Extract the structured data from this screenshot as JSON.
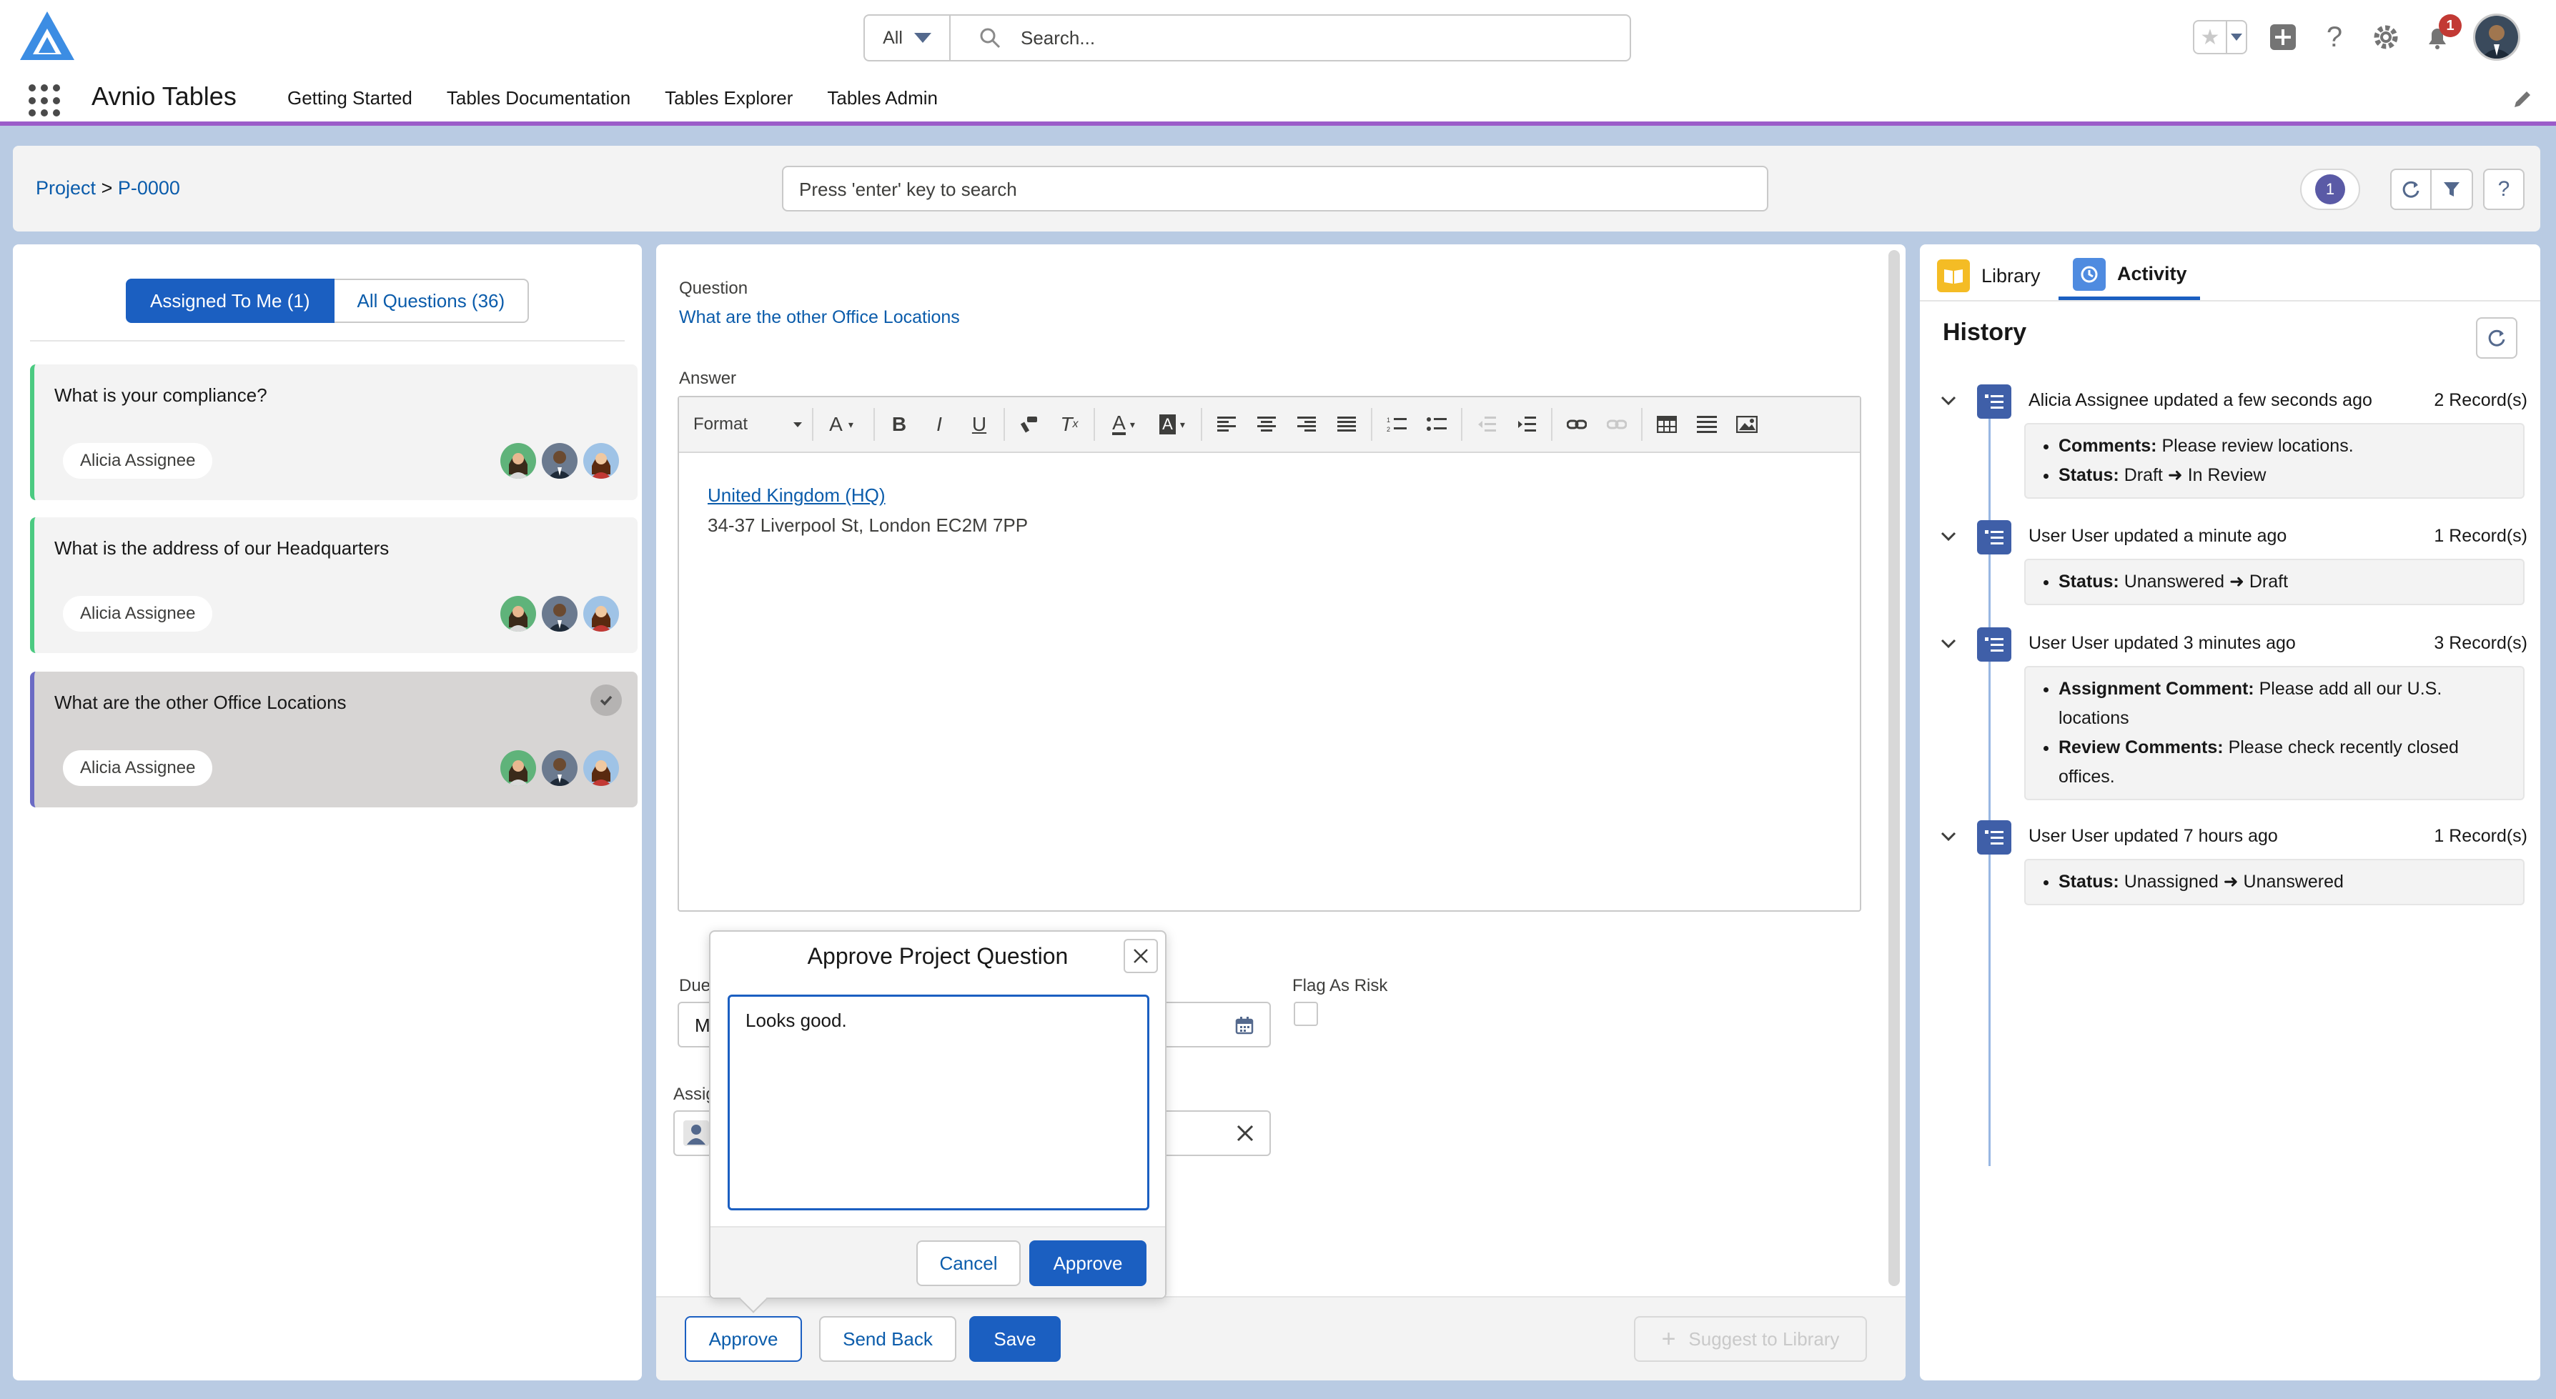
{
  "app": {
    "name": "Avnio Tables",
    "nav": [
      "Getting Started",
      "Tables Documentation",
      "Tables Explorer",
      "Tables Admin"
    ],
    "notification_count": "1"
  },
  "global_search": {
    "scope": "All",
    "placeholder": "Search..."
  },
  "breadcrumb": {
    "parent": "Project",
    "separator": ">",
    "current": "P-0000"
  },
  "sub_search": {
    "placeholder": "Press 'enter' key to search"
  },
  "filter_count": "1",
  "left": {
    "tabs": {
      "assigned": "Assigned To Me (1)",
      "all": "All Questions (36)"
    },
    "questions": [
      {
        "title": "What is your compliance?",
        "assignee": "Alicia Assignee"
      },
      {
        "title": "What is the address of our Headquarters",
        "assignee": "Alicia Assignee"
      },
      {
        "title": "What are the other Office Locations",
        "assignee": "Alicia Assignee"
      }
    ]
  },
  "main": {
    "question_label": "Question",
    "question_text": "What are the other Office Locations",
    "answer_label": "Answer",
    "format_label": "Format",
    "answer_link": "United Kingdom (HQ)",
    "answer_line": "34-37 Liverpool St, London EC2M 7PP",
    "due_label": "Due",
    "due_value": "M",
    "assign_label": "Assig",
    "flag_label": "Flag As Risk",
    "buttons": {
      "approve": "Approve",
      "send_back": "Send Back",
      "save": "Save",
      "suggest": "Suggest to Library"
    }
  },
  "popover": {
    "title": "Approve Project Question",
    "text": "Looks good.",
    "cancel": "Cancel",
    "approve": "Approve"
  },
  "right": {
    "tabs": {
      "library": "Library",
      "activity": "Activity"
    },
    "history_title": "History",
    "entries": [
      {
        "text": "Alicia Assignee updated a few seconds ago",
        "count": "2 Record(s)",
        "items": [
          {
            "label": "Comments:",
            "value": "Please review locations."
          },
          {
            "label": "Status:",
            "value": "Draft ➜ In Review"
          }
        ]
      },
      {
        "text": "User User updated a minute ago",
        "count": "1 Record(s)",
        "items": [
          {
            "label": "Status:",
            "value": "Unanswered ➜ Draft"
          }
        ]
      },
      {
        "text": "User User updated 3 minutes ago",
        "count": "3 Record(s)",
        "items": [
          {
            "label": "Assignment Comment:",
            "value": "Please add all our U.S. locations"
          },
          {
            "label": "Review Comments:",
            "value": "Please check recently closed offices."
          }
        ]
      },
      {
        "text": "User User updated 7 hours ago",
        "count": "1 Record(s)",
        "items": [
          {
            "label": "Status:",
            "value": "Unassigned ➜ Unanswered"
          }
        ]
      }
    ]
  },
  "colors": {
    "brand": "#1b5fc1",
    "link": "#0b5cab",
    "success": "#4bca81",
    "accent": "#9b5cc9"
  }
}
